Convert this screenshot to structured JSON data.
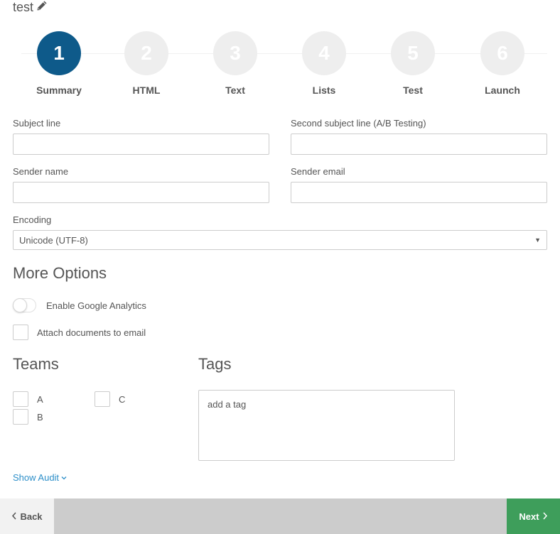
{
  "page": {
    "title": "test"
  },
  "steps": [
    {
      "number": "1",
      "label": "Summary",
      "active": true
    },
    {
      "number": "2",
      "label": "HTML",
      "active": false
    },
    {
      "number": "3",
      "label": "Text",
      "active": false
    },
    {
      "number": "4",
      "label": "Lists",
      "active": false
    },
    {
      "number": "5",
      "label": "Test",
      "active": false
    },
    {
      "number": "6",
      "label": "Launch",
      "active": false
    }
  ],
  "form": {
    "subject_line_label": "Subject line",
    "subject_line_value": "",
    "second_subject_label": "Second subject line (A/B Testing)",
    "second_subject_value": "",
    "sender_name_label": "Sender name",
    "sender_name_value": "",
    "sender_email_label": "Sender email",
    "sender_email_value": "",
    "encoding_label": "Encoding",
    "encoding_value": "Unicode (UTF-8)"
  },
  "more_options": {
    "heading": "More Options",
    "google_analytics_label": "Enable Google Analytics",
    "google_analytics_enabled": false,
    "attach_documents_label": "Attach documents to email",
    "attach_documents_checked": false
  },
  "teams": {
    "heading": "Teams",
    "items": [
      {
        "label": "A",
        "checked": false
      },
      {
        "label": "B",
        "checked": false
      },
      {
        "label": "C",
        "checked": false
      }
    ]
  },
  "tags": {
    "heading": "Tags",
    "placeholder": "add a tag"
  },
  "audit": {
    "link_label": "Show Audit"
  },
  "footer": {
    "back_label": "Back",
    "next_label": "Next"
  },
  "colors": {
    "active_step": "#0e5a8a",
    "inactive_step": "#eeeeee",
    "next_button": "#3e9e5b",
    "link": "#2d8fc9",
    "footer_bar": "#cccccc"
  }
}
